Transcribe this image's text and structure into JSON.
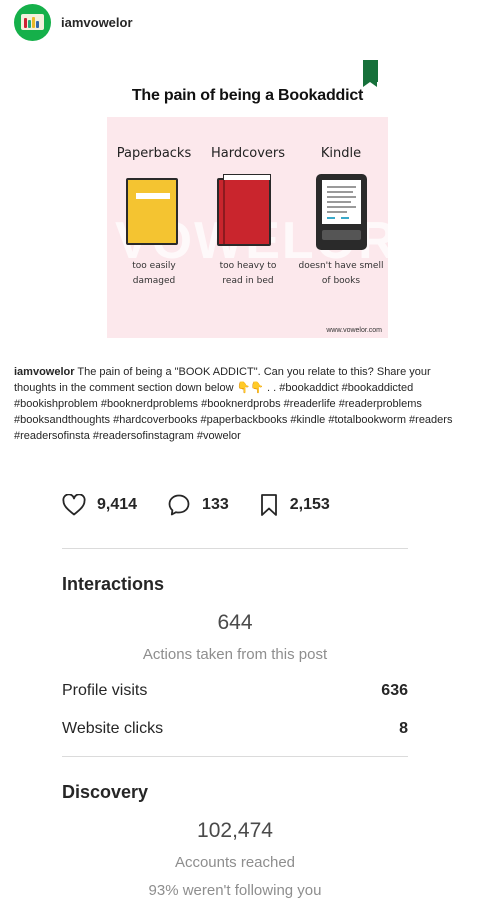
{
  "header": {
    "username": "iamvowelor"
  },
  "post_image": {
    "title": "The pain of being a Bookaddict",
    "columns": [
      {
        "heading": "Paperbacks",
        "caption_line1": "too easily",
        "caption_line2": "damaged"
      },
      {
        "heading": "Hardcovers",
        "caption_line1": "too heavy to",
        "caption_line2": "read in bed"
      },
      {
        "heading": "Kindle",
        "caption_line1": "doesn't have smell",
        "caption_line2": "of books"
      }
    ],
    "watermark": "VOWELOR",
    "site": "www.vowelor.com"
  },
  "caption": {
    "username": "iamvowelor",
    "text": "The pain of being a \"BOOK ADDICT\". Can you relate to this? Share your thoughts in the comment section down below 👇👇 . . #bookaddict #bookaddicted #bookishproblem #booknerdproblems #booknerdprobs #readerlife #readerproblems #booksandthoughts #hardcoverbooks #paperbackbooks #kindle #totalbookworm #readers #readersofinsta #readersofinstagram #vowelor"
  },
  "stats": {
    "likes": "9,414",
    "comments": "133",
    "saves": "2,153"
  },
  "interactions": {
    "title": "Interactions",
    "total": "644",
    "subtitle": "Actions taken from this post",
    "rows": [
      {
        "label": "Profile visits",
        "value": "636"
      },
      {
        "label": "Website clicks",
        "value": "8"
      }
    ]
  },
  "discovery": {
    "title": "Discovery",
    "total": "102,474",
    "subtitle": "Accounts reached",
    "note": "93% weren't following you"
  },
  "colors": {
    "avatar": "#15b04a",
    "panel": "#fce8ec",
    "paperback": "#f4c431",
    "hardcover": "#c9252d"
  }
}
